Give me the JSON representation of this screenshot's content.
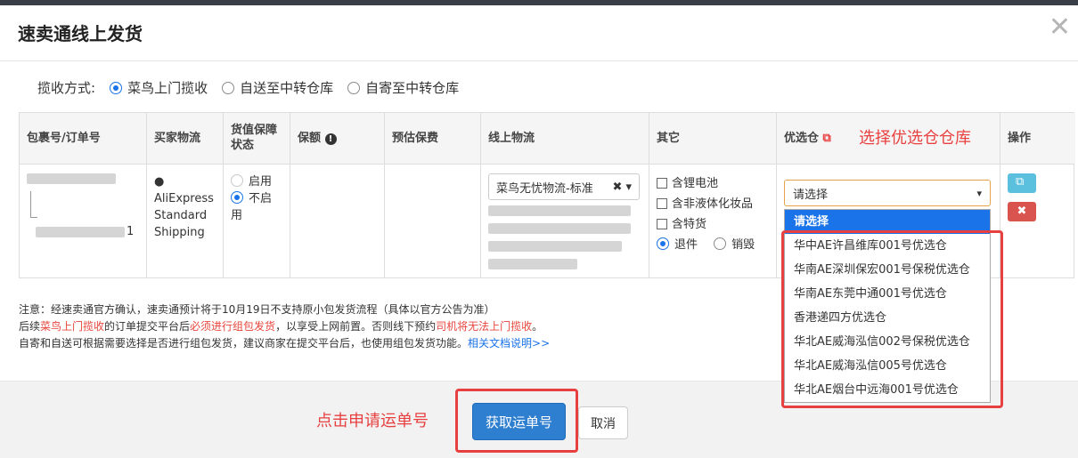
{
  "dialog": {
    "title": "速卖通线上发货",
    "close_glyph": "✕"
  },
  "pickup": {
    "label": "揽收方式:",
    "options": [
      "菜鸟上门揽收",
      "自送至中转仓库",
      "自寄至中转仓库"
    ],
    "selected": "菜鸟上门揽收"
  },
  "table": {
    "headers": {
      "package": "包裹号/订单号",
      "buyer": "买家物流",
      "value_protect": "货值保障状态",
      "insured": "保额",
      "est_fee": "预估保费",
      "online_logistics": "线上物流",
      "other": "其它",
      "warehouse": "优选仓",
      "ops": "操作"
    },
    "row": {
      "package_suffix": "1",
      "buyer_logistics": "AliExpress Standard Shipping",
      "protect_options": [
        "启用",
        "不启用"
      ],
      "logistics_selected": "菜鸟无忧物流-标准",
      "other_checks": [
        "含锂电池",
        "含非液体化妆品",
        "含特货"
      ],
      "return_options": [
        "退件",
        "销毁"
      ],
      "warehouse_placeholder": "请选择"
    }
  },
  "warehouse_dropdown": [
    "请选择",
    "华中AE许昌维库001号优选仓",
    "华南AE深圳保宏001号保税优选仓",
    "华南AE东莞中通001号优选仓",
    "香港递四方优选仓",
    "华北AE威海泓信002号保税优选仓",
    "华北AE威海泓信005号优选仓",
    "华北AE烟台中远海001号优选仓"
  ],
  "annotations": {
    "choose_warehouse": "选择优选仓仓库",
    "click_apply": "点击申请运单号"
  },
  "notes": {
    "line1": "注意：经速卖通官方确认，速卖通预计将于10月19日不支持原小包发货流程（具体以官方公告为准）",
    "line2_a": "后续",
    "line2_b": "菜鸟上门揽收",
    "line2_c": "的订单提交平台后",
    "line2_d": "必须进行组包发货",
    "line2_e": "，以享受上网前置。否则线下预约",
    "line2_f": "司机将无法上门揽收",
    "line2_g": "。",
    "line3_a": "自寄和自送可根据需要选择是否进行组包发货，建议商家在提交平台后，也使用组包发货功能。",
    "line3_link": "相关文档说明>>"
  },
  "buttons": {
    "get_tracking": "获取运单号",
    "cancel": "取消"
  },
  "colors": {
    "primary": "#2f7fd1",
    "annotation": "#e84040",
    "link": "#1a73e8"
  }
}
